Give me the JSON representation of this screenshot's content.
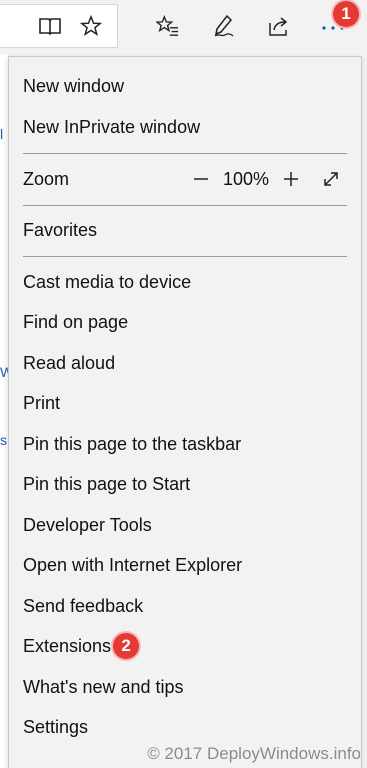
{
  "toolbar": {
    "icons": [
      "reading-view-icon",
      "favorite-star-icon",
      "favorites-hub-icon",
      "pen-notes-icon",
      "share-icon",
      "more-actions-icon"
    ],
    "more_badge": "1"
  },
  "menu": {
    "new_window": "New window",
    "new_inprivate": "New InPrivate window",
    "zoom_label": "Zoom",
    "zoom_value": "100%",
    "favorites": "Favorites",
    "cast": "Cast media to device",
    "find": "Find on page",
    "read_aloud": "Read aloud",
    "print": "Print",
    "pin_taskbar": "Pin this page to the taskbar",
    "pin_start": "Pin this page to Start",
    "dev_tools": "Developer Tools",
    "open_ie": "Open with Internet Explorer",
    "feedback": "Send feedback",
    "extensions": "Extensions",
    "extensions_badge": "2",
    "whats_new": "What's new and tips",
    "settings": "Settings"
  },
  "watermark": "© 2017 DeployWindows.info",
  "colors": {
    "badge": "#e53935",
    "menu_bg": "#f2f2f2",
    "more_icon": "#0063b1"
  }
}
